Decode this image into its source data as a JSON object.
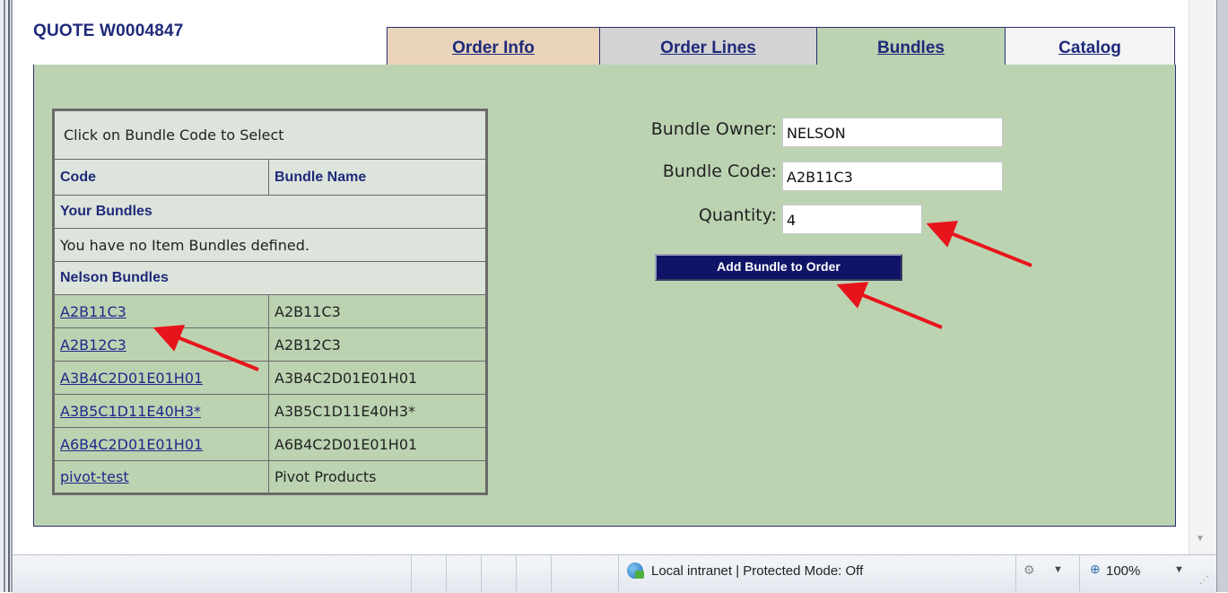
{
  "quote": {
    "title": "QUOTE W0004847"
  },
  "tabs": [
    {
      "label": "Order Info"
    },
    {
      "label": "Order Lines"
    },
    {
      "label": "Bundles"
    },
    {
      "label": "Catalog"
    }
  ],
  "bundle_table": {
    "caption": "Click on Bundle Code to Select",
    "headers": {
      "code": "Code",
      "name": "Bundle Name"
    },
    "your_bundles": {
      "heading": "Your Bundles",
      "empty_message": "You have no Item Bundles defined."
    },
    "nelson_bundles": {
      "heading": "Nelson Bundles",
      "rows": [
        {
          "code": "A2B11C3",
          "name": "A2B11C3"
        },
        {
          "code": "A2B12C3",
          "name": "A2B12C3"
        },
        {
          "code": "A3B4C2D01E01H01",
          "name": "A3B4C2D01E01H01"
        },
        {
          "code": "A3B5C1D11E40H3*",
          "name": "A3B5C1D11E40H3*"
        },
        {
          "code": "A6B4C2D01E01H01",
          "name": "A6B4C2D01E01H01"
        },
        {
          "code": "pivot-test",
          "name": "Pivot Products"
        }
      ]
    }
  },
  "form": {
    "owner_label": "Bundle Owner:",
    "owner_value": "NELSON",
    "code_label": "Bundle Code:",
    "code_value": "A2B11C3",
    "quantity_label": "Quantity:",
    "quantity_value": "4",
    "add_button": "Add Bundle to Order"
  },
  "statusbar": {
    "zone": "Local intranet | Protected Mode: Off",
    "zoom": "100%"
  },
  "colors": {
    "panel_bg": "#bcd3b2",
    "title_blue": "#1f2a7a",
    "button_bg": "#0f1466",
    "arrow_red": "#e8141b"
  }
}
